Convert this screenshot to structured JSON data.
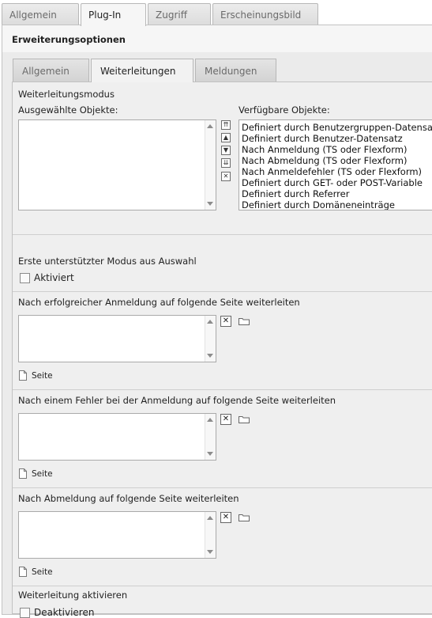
{
  "top_tabs": [
    {
      "label": "Allgemein"
    },
    {
      "label": "Plug-In"
    },
    {
      "label": "Zugriff"
    },
    {
      "label": "Erscheinungsbild"
    }
  ],
  "active_top_tab": "Plug-In",
  "section_title": "Erweiterungsoptionen",
  "sub_tabs": [
    {
      "label": "Allgemein"
    },
    {
      "label": "Weiterleitungen"
    },
    {
      "label": "Meldungen"
    }
  ],
  "active_sub_tab": "Weiterleitungen",
  "redirect_mode": {
    "label": "Weiterleitungsmodus",
    "selected_label": "Ausgewählte Objekte:",
    "available_label": "Verfügbare Objekte:",
    "available_items": [
      "Definiert durch Benutzergruppen-Datensatz",
      "Definiert durch Benutzer-Datensatz",
      "Nach Anmeldung (TS oder Flexform)",
      "Nach Abmeldung (TS oder Flexform)",
      "Nach Anmeldefehler (TS oder Flexform)",
      "Definiert durch GET- oder POST-Variable",
      "Definiert durch Referrer",
      "Definiert durch Domäneneinträge"
    ]
  },
  "first_mode": {
    "label": "Erste unterstützter Modus aus Auswahl",
    "checkbox_label": "Aktiviert"
  },
  "after_login": {
    "label": "Nach erfolgreicher Anmeldung auf folgende Seite weiterleiten",
    "page_label": "Seite"
  },
  "after_error": {
    "label": "Nach einem Fehler bei der Anmeldung auf folgende Seite weiterleiten",
    "page_label": "Seite"
  },
  "after_logout": {
    "label": "Nach Abmeldung auf folgende Seite weiterleiten",
    "page_label": "Seite"
  },
  "activate_redirect": {
    "label": "Weiterleitung aktivieren",
    "checkbox_label": "Deaktivieren"
  },
  "icons": {
    "remove": "✕",
    "move_top": "⇈",
    "move_up": "▲",
    "move_down": "▼",
    "move_bottom": "⇊"
  }
}
